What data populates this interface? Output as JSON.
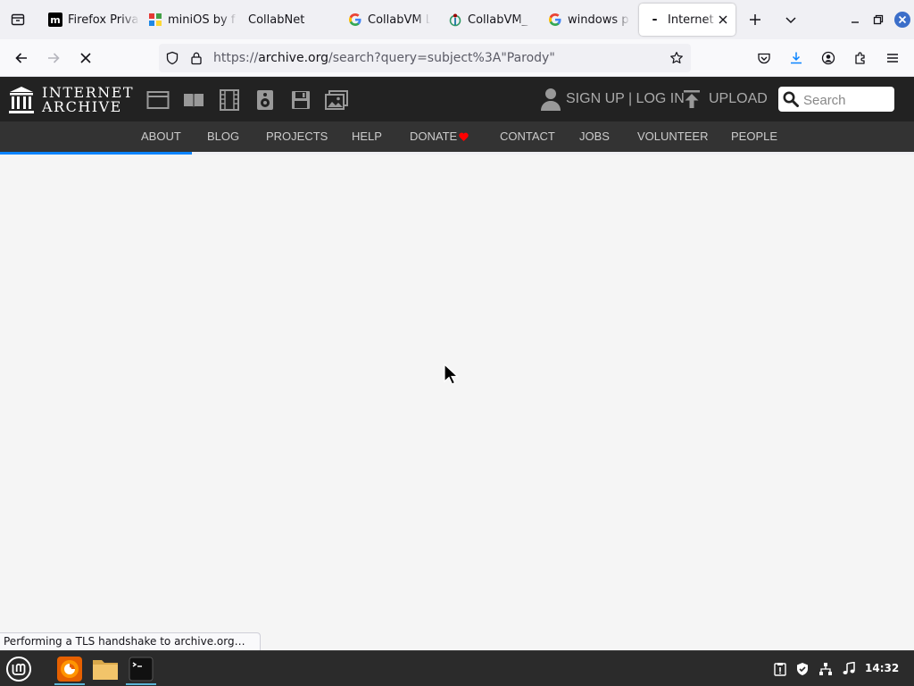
{
  "browser": {
    "tabs": [
      {
        "title": "Firefox Privacy Notice",
        "favicon": "mozilla-m-icon",
        "active": false
      },
      {
        "title": "miniOS by f",
        "favicon": "minios-icon",
        "active": false
      },
      {
        "title": "CollabNet",
        "favicon": "blank-icon",
        "active": false
      },
      {
        "title": "CollabVM Login",
        "favicon": "google-g-icon",
        "active": false
      },
      {
        "title": "CollabVM_",
        "favicon": "wikimedia-icon",
        "active": false
      },
      {
        "title": "windows p",
        "favicon": "google-g-icon",
        "active": false
      },
      {
        "title": "Internet Archive",
        "favicon": "loading-dot-icon",
        "active": true
      }
    ],
    "url": {
      "scheme": "https://",
      "host": "archive.org",
      "path": "/search?query=subject%3A\"Parody\""
    },
    "status_text": "Performing a TLS handshake to archive.org…",
    "page_load_progress_percent": 21
  },
  "archive": {
    "logo_line1": "INTERNET",
    "logo_line2": "ARCHIVE",
    "media_icons": [
      "web-icon",
      "texts-icon",
      "video-icon",
      "audio-icon",
      "software-icon",
      "images-icon"
    ],
    "account_label": "SIGN UP | LOG IN",
    "upload_label": "UPLOAD",
    "search_placeholder": "Search",
    "subnav": [
      "ABOUT",
      "BLOG",
      "PROJECTS",
      "HELP",
      "DONATE",
      "CONTACT",
      "JOBS",
      "VOLUNTEER",
      "PEOPLE"
    ],
    "donate_heart_color": "#f00"
  },
  "taskbar": {
    "apps": [
      "mint-menu-icon",
      "firefox-icon",
      "files-icon",
      "terminal-icon"
    ],
    "tray": [
      "update-icon",
      "shield-icon",
      "network-icon",
      "sound-icon"
    ],
    "clock": "14:32"
  }
}
